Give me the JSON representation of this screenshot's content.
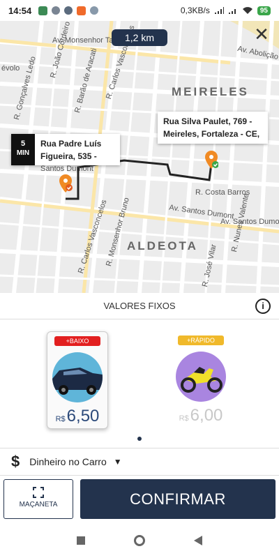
{
  "status": {
    "time": "14:54",
    "network": "0,3KB/s",
    "battery": "95"
  },
  "map": {
    "distance": "1,2 km",
    "close_icon": "close-icon",
    "destination": {
      "line1": "Rua Silva Paulet, 769 -",
      "line2": "Meireles, Fortaleza - CE,"
    },
    "origin": {
      "eta_value": "5",
      "eta_unit": "MIN",
      "line1": "Rua Padre Luís",
      "line2": "Figueira, 535 -"
    },
    "labels": {
      "meireles": "MEIRELES",
      "aldeota": "ALDEOTA",
      "monsenhor_tabosa": "Av. Monsenhor Tabosa",
      "abolicao": "Av. Abolição",
      "santos_dumont_1": "Av. Santos Dumont",
      "santos_dumont_2": "Av. Santos Dumont",
      "santos_dumont_3": "Santos Dumont",
      "costa_barros": "R. Costa Barros",
      "carlos_vasconcelos_1": "R. Carlos Vasconcelos",
      "carlos_vasconcelos_2": "R. Carlos Vasconcelos",
      "monsenhor_bruno": "R. Monsenhor Bruno",
      "barao_aracati": "R. Barão de Aracati",
      "joao_cordeiro": "R. João Cordeiro",
      "goncalves_ledo": "R. Gonçalves Ledo",
      "nunes_valente": "R. Nunes Valente",
      "jose_vilar": "R. José Vilar",
      "volo": "évolo"
    }
  },
  "panel": {
    "header": "VALORES FIXOS",
    "info_icon": "info-icon",
    "options": [
      {
        "badge": "+BAIXO",
        "badge_color": "#e21f1f",
        "currency": "R$",
        "price": "6,50",
        "vehicle_icon": "car-icon"
      },
      {
        "badge": "+RÁPIDO",
        "badge_color": "#f0b92b",
        "currency": "R$",
        "price": "6,00",
        "vehicle_icon": "motorcycle-icon"
      }
    ],
    "payment": {
      "icon": "dollar-icon",
      "label": "Dinheiro no Carro"
    },
    "maçaneta_label": "MAÇANETA",
    "confirm_label": "CONFIRMAR"
  },
  "colors": {
    "primary": "#23334d",
    "pin": "#f08a24",
    "check": "#3aa64a"
  }
}
